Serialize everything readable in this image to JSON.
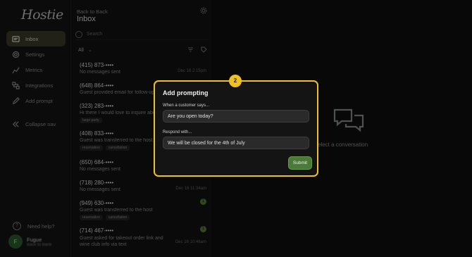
{
  "app": {
    "logo": "Hostie"
  },
  "sidebar": {
    "items": [
      {
        "label": "Inbox",
        "icon": "inbox-icon",
        "active": true
      },
      {
        "label": "Settings",
        "icon": "gear-icon",
        "active": false
      },
      {
        "label": "Metrics",
        "icon": "chart-icon",
        "active": false
      },
      {
        "label": "Integrations",
        "icon": "integrations-icon",
        "active": false
      },
      {
        "label": "Add prompt",
        "icon": "pen-icon",
        "active": false
      },
      {
        "label": "Collapse nav",
        "icon": "collapse-icon",
        "active": false
      }
    ],
    "help_label": "Need help?",
    "help_icon": "?",
    "user": {
      "initial": "F",
      "name": "Fugue",
      "sub": "Back to Bank"
    }
  },
  "list": {
    "back_label": "Back to Back",
    "title": "Inbox",
    "search_placeholder": "Search",
    "filter_label": "All",
    "filter_chevron": "⌄",
    "conversations": [
      {
        "phone": "(415) 873-••••",
        "message": "No messages sent",
        "time": "Dec 16 2:15pm",
        "tags": [],
        "badge": ""
      },
      {
        "phone": "(648) 864-••••",
        "message": "Guest provided email for follow-up",
        "time": "",
        "tags": [],
        "badge": ""
      },
      {
        "phone": "(323) 283-••••",
        "message": "Hi there I would love to inquire about",
        "time": "",
        "tags": [
          "large party"
        ],
        "badge": ""
      },
      {
        "phone": "(408) 833-••••",
        "message": "Guest was transferred to the host",
        "time": "",
        "tags": [
          "reservation",
          "cancellation"
        ],
        "badge": ""
      },
      {
        "phone": "(650) 684-••••",
        "message": "No messages sent",
        "time": "",
        "tags": [],
        "badge": ""
      },
      {
        "phone": "(718) 280-••••",
        "message": "No messages sent",
        "time": "Dec 16 11:34am",
        "tags": [],
        "badge": ""
      },
      {
        "phone": "(949) 630-••••",
        "message": "Guest was transferred to the host",
        "time": "",
        "tags": [
          "reservation",
          "cancellation"
        ],
        "badge": "1"
      },
      {
        "phone": "(714) 467-••••",
        "message": "Guest asked for takeout order link and wine club info via text",
        "time": "Dec 16 10:46am",
        "tags": [],
        "badge": "1"
      }
    ]
  },
  "empty_state": {
    "label": "elect a conversation",
    "icon": "chat-bubbles-icon"
  },
  "modal": {
    "step": "2",
    "title": "Add prompting",
    "trigger_label": "When a customer says...",
    "trigger_value": "Are you open today?",
    "response_label": "Respond with...",
    "response_value": "We will be closed for the 4th of July",
    "submit_label": "Submit"
  },
  "colors": {
    "accent": "#f0c020",
    "submit": "#4a7a3a",
    "active_nav": "#3a3a2a"
  }
}
